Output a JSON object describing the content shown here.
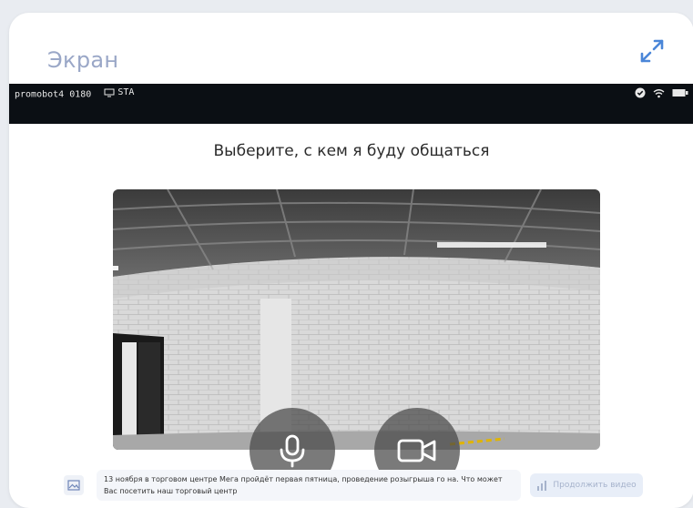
{
  "panel": {
    "title": "Экран"
  },
  "status_bar": {
    "device": "promobot4 0180",
    "network": "STA"
  },
  "screen": {
    "prompt": "Выберите, с кем я буду общаться"
  },
  "message": {
    "text": "13 ноября в торговом центре Мега пройдёт первая пятница, проведение розыгрыша го на. Что может Вас посетить наш торговый центр"
  },
  "speak_button": {
    "label": "Продолжить видео"
  },
  "colors": {
    "title": "#9aa7c7",
    "accent": "#4a86d8",
    "button_overlay": "#464646"
  },
  "icons": [
    "expand-icon",
    "wifi-icon",
    "battery-icon",
    "check-circle-icon",
    "microphone-icon",
    "video-camera-icon",
    "image-icon",
    "bar-chart-icon"
  ]
}
